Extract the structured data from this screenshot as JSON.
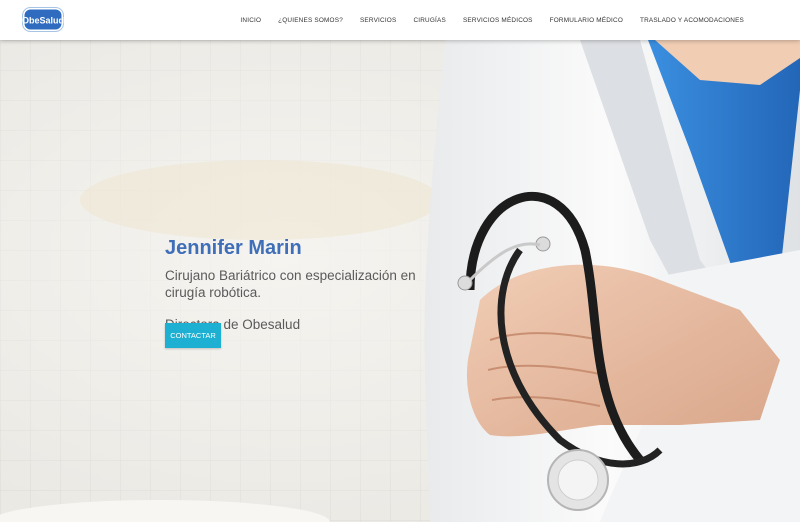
{
  "header": {
    "logo_text": "ObeSalud",
    "nav": [
      {
        "label": "INICIO"
      },
      {
        "label": "¿QUIENES SOMOS?"
      },
      {
        "label": "SERVICIOS"
      },
      {
        "label": "CIRUGÍAS"
      },
      {
        "label": "SERVICIOS MÉDICOS"
      },
      {
        "label": "FORMULARIO MÉDICO"
      },
      {
        "label": "TRASLADO Y ACOMODACIONES"
      }
    ]
  },
  "hero": {
    "name": "Jennifer Marin",
    "subtitle": "Cirujano Bariátrico con especialización en cirugía robótica.",
    "role": "Directora de Obesalud",
    "cta_label": "CONTACTAR"
  },
  "colors": {
    "accent": "#3f6fb8",
    "button": "#1eb0d2",
    "scrubs": "#2f7fd0"
  },
  "icons": {
    "hero_image": "doctor-with-stethoscope"
  }
}
